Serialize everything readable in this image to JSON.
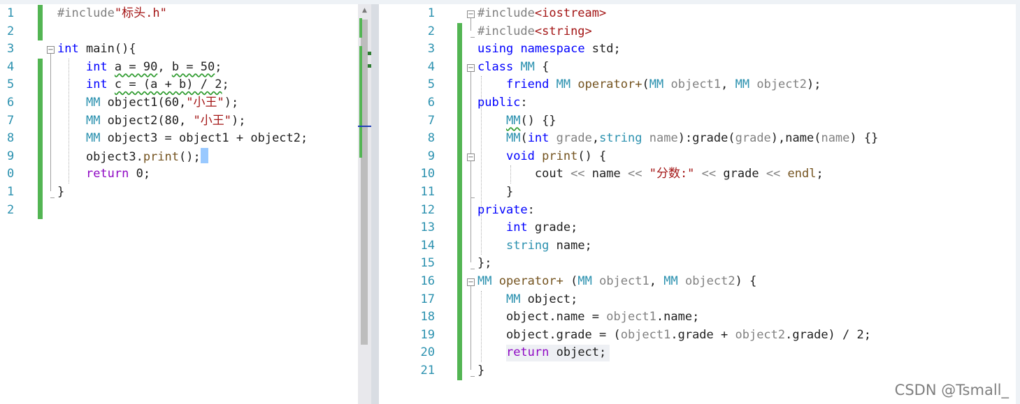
{
  "left_editor": {
    "line_numbers": [
      "1",
      "2",
      "3",
      "4",
      "5",
      "6",
      "7",
      "8",
      "9",
      "0",
      "1",
      "2"
    ],
    "lines": [
      [
        {
          "t": "#include",
          "c": "pp"
        },
        {
          "t": "\"标头.h\"",
          "c": "st"
        }
      ],
      [],
      [
        {
          "t": "int",
          "c": "kw"
        },
        {
          "t": " main(){"
        }
      ],
      [
        {
          "t": "    "
        },
        {
          "t": "int",
          "c": "kw"
        },
        {
          "t": " "
        },
        {
          "t": "a = 90",
          "c": "sq"
        },
        {
          "t": ", "
        },
        {
          "t": "b = 50",
          "c": "sq"
        },
        {
          "t": ";"
        }
      ],
      [
        {
          "t": "    "
        },
        {
          "t": "int",
          "c": "kw"
        },
        {
          "t": " "
        },
        {
          "t": "c = (a + b) / 2",
          "c": "sq"
        },
        {
          "t": ";"
        }
      ],
      [
        {
          "t": "    "
        },
        {
          "t": "MM",
          "c": "ty"
        },
        {
          "t": " object1(60,"
        },
        {
          "t": "\"小王\"",
          "c": "st"
        },
        {
          "t": ");"
        }
      ],
      [
        {
          "t": "    "
        },
        {
          "t": "MM",
          "c": "ty"
        },
        {
          "t": " object2(80, "
        },
        {
          "t": "\"小王\"",
          "c": "st"
        },
        {
          "t": ");"
        }
      ],
      [
        {
          "t": "    "
        },
        {
          "t": "MM",
          "c": "ty"
        },
        {
          "t": " object3 = object1 + object2;"
        }
      ],
      [
        {
          "t": "    object3."
        },
        {
          "t": "print",
          "c": "fn"
        },
        {
          "t": "();"
        }
      ],
      [
        {
          "t": "    "
        },
        {
          "t": "return",
          "c": "ctl"
        },
        {
          "t": " 0;"
        }
      ],
      [
        {
          "t": "}"
        }
      ],
      []
    ]
  },
  "right_editor": {
    "line_numbers": [
      "1",
      "2",
      "3",
      "4",
      "5",
      "6",
      "7",
      "8",
      "9",
      "10",
      "11",
      "12",
      "13",
      "14",
      "15",
      "16",
      "17",
      "18",
      "19",
      "20",
      "21"
    ],
    "lines": [
      [
        {
          "t": "#include",
          "c": "pp"
        },
        {
          "t": "<iostream>",
          "c": "st"
        }
      ],
      [
        {
          "t": "#include",
          "c": "pp"
        },
        {
          "t": "<string>",
          "c": "st"
        }
      ],
      [
        {
          "t": "using",
          "c": "kw"
        },
        {
          "t": " "
        },
        {
          "t": "namespace",
          "c": "kw"
        },
        {
          "t": " std;"
        }
      ],
      [
        {
          "t": "class",
          "c": "kw"
        },
        {
          "t": " "
        },
        {
          "t": "MM",
          "c": "ty"
        },
        {
          "t": " {"
        }
      ],
      [
        {
          "t": "    "
        },
        {
          "t": "friend",
          "c": "kw"
        },
        {
          "t": " "
        },
        {
          "t": "MM",
          "c": "ty"
        },
        {
          "t": " "
        },
        {
          "t": "operator+",
          "c": "fn"
        },
        {
          "t": "("
        },
        {
          "t": "MM",
          "c": "ty"
        },
        {
          "t": " "
        },
        {
          "t": "object1",
          "c": "pm"
        },
        {
          "t": ", "
        },
        {
          "t": "MM",
          "c": "ty"
        },
        {
          "t": " "
        },
        {
          "t": "object2",
          "c": "pm"
        },
        {
          "t": ");"
        }
      ],
      [
        {
          "t": "public",
          "c": "kw"
        },
        {
          "t": ":"
        }
      ],
      [
        {
          "t": "    "
        },
        {
          "t": "MM",
          "c": "ty sq"
        },
        {
          "t": "() {}"
        }
      ],
      [
        {
          "t": "    "
        },
        {
          "t": "MM",
          "c": "ty"
        },
        {
          "t": "("
        },
        {
          "t": "int",
          "c": "kw"
        },
        {
          "t": " "
        },
        {
          "t": "grade",
          "c": "pm"
        },
        {
          "t": ","
        },
        {
          "t": "string",
          "c": "ty"
        },
        {
          "t": " "
        },
        {
          "t": "name",
          "c": "pm"
        },
        {
          "t": "):grade("
        },
        {
          "t": "grade",
          "c": "pm"
        },
        {
          "t": "),name("
        },
        {
          "t": "name",
          "c": "pm"
        },
        {
          "t": ") {}"
        }
      ],
      [
        {
          "t": "    "
        },
        {
          "t": "void",
          "c": "kw"
        },
        {
          "t": " "
        },
        {
          "t": "print",
          "c": "fn"
        },
        {
          "t": "() {"
        }
      ],
      [
        {
          "t": "        cout "
        },
        {
          "t": "<<",
          "c": "pm"
        },
        {
          "t": " name "
        },
        {
          "t": "<<",
          "c": "pm"
        },
        {
          "t": " "
        },
        {
          "t": "\"分数:\"",
          "c": "st"
        },
        {
          "t": " "
        },
        {
          "t": "<<",
          "c": "pm"
        },
        {
          "t": " grade "
        },
        {
          "t": "<<",
          "c": "pm"
        },
        {
          "t": " "
        },
        {
          "t": "endl",
          "c": "fn"
        },
        {
          "t": ";"
        }
      ],
      [
        {
          "t": "    }"
        }
      ],
      [
        {
          "t": "private",
          "c": "kw"
        },
        {
          "t": ":"
        }
      ],
      [
        {
          "t": "    "
        },
        {
          "t": "int",
          "c": "kw"
        },
        {
          "t": " grade;"
        }
      ],
      [
        {
          "t": "    "
        },
        {
          "t": "string",
          "c": "ty"
        },
        {
          "t": " name;"
        }
      ],
      [
        {
          "t": "};"
        }
      ],
      [
        {
          "t": "MM",
          "c": "ty"
        },
        {
          "t": " "
        },
        {
          "t": "operator+",
          "c": "fn"
        },
        {
          "t": " ("
        },
        {
          "t": "MM",
          "c": "ty"
        },
        {
          "t": " "
        },
        {
          "t": "object1",
          "c": "pm"
        },
        {
          "t": ", "
        },
        {
          "t": "MM",
          "c": "ty"
        },
        {
          "t": " "
        },
        {
          "t": "object2",
          "c": "pm"
        },
        {
          "t": ") {"
        }
      ],
      [
        {
          "t": "    "
        },
        {
          "t": "MM",
          "c": "ty"
        },
        {
          "t": " object;"
        }
      ],
      [
        {
          "t": "    object.name = "
        },
        {
          "t": "object1",
          "c": "pm"
        },
        {
          "t": ".name;"
        }
      ],
      [
        {
          "t": "    object.grade = ("
        },
        {
          "t": "object1",
          "c": "pm"
        },
        {
          "t": ".grade + "
        },
        {
          "t": "object2",
          "c": "pm"
        },
        {
          "t": ".grade) / 2;"
        }
      ],
      [
        {
          "t": "    "
        },
        {
          "t": "return",
          "c": "ctl"
        },
        {
          "t": " object;"
        }
      ],
      [
        {
          "t": "}"
        }
      ]
    ]
  },
  "watermark": "CSDN @Tsmall_",
  "colors": {
    "keyword": "#0000ff",
    "type": "#2b91af",
    "string": "#a31515",
    "preprocessor": "#808080",
    "parameter": "#808080",
    "function": "#74531f",
    "control": "#8f08c4",
    "change_bar": "#53b553"
  }
}
